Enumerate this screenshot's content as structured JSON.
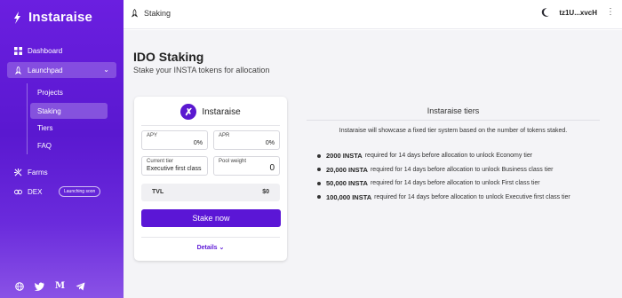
{
  "app": {
    "name": "Instaraise"
  },
  "sidebar": {
    "dashboard": "Dashboard",
    "launchpad": "Launchpad",
    "sub_items": [
      "Projects",
      "Staking",
      "Tiers",
      "FAQ"
    ],
    "farms": "Farms",
    "dex": "DEX",
    "dex_badge": "Launching soon"
  },
  "socials": [
    "globe-icon",
    "twitter-icon",
    "medium-icon",
    "telegram-icon"
  ],
  "header": {
    "title": "Staking",
    "wallet_address": "tz1U...xvcH"
  },
  "page": {
    "title": "IDO Staking",
    "subtitle": "Stake your INSTA tokens for allocation"
  },
  "card": {
    "name": "Instaraise",
    "apy_label": "APY",
    "apy_value": "0%",
    "apr_label": "APR",
    "apr_value": "0%",
    "current_tier_label": "Current tier",
    "current_tier_value": "Executive first class",
    "pool_weight_label": "Pool weight",
    "pool_weight_value": "0",
    "tvl_label": "TVL",
    "tvl_value": "$0",
    "stake_button": "Stake now",
    "details": "Details"
  },
  "tiers": {
    "title": "Instaraise tiers",
    "description": "Instaraise will showcase a fixed tier system based on the number of tokens staked.",
    "items": [
      {
        "amount": "2000 INSTA",
        "text": "required for 14 days before allocation to unlock Economy tier"
      },
      {
        "amount": "20,000 INSTA",
        "text": "required for 14 days before allocation to unlock Business class tier"
      },
      {
        "amount": "50,000 INSTA",
        "text": "required for 14 days before allocation to unlock First class tier"
      },
      {
        "amount": "100,000 INSTA",
        "text": "required for 14 days before allocation to unlock Executive first class tier"
      }
    ]
  },
  "colors": {
    "primary": "#5b16d6",
    "sidebar_top": "#6b1fe0",
    "sidebar_bottom": "#8a52e6"
  }
}
